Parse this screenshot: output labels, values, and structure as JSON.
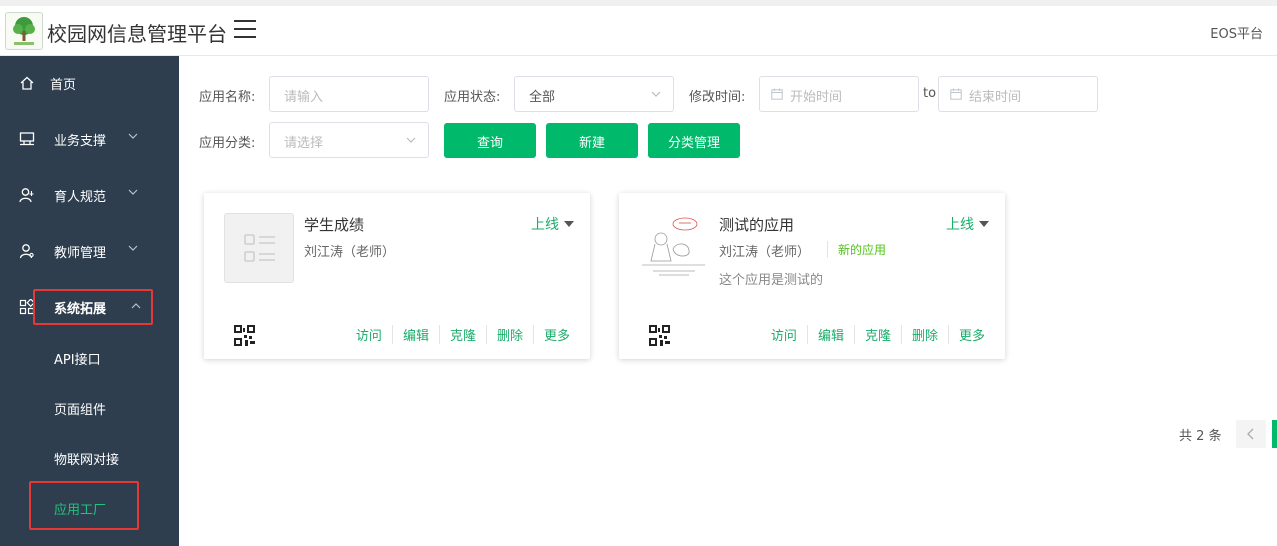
{
  "header": {
    "title": "校园网信息管理平台",
    "platform": "EOS平台"
  },
  "sidebar": {
    "items": [
      {
        "label": "首页",
        "icon": "home-icon"
      },
      {
        "label": "业务支撑",
        "icon": "monitor-icon"
      },
      {
        "label": "育人规范",
        "icon": "user-icon"
      },
      {
        "label": "教师管理",
        "icon": "teacher-icon"
      },
      {
        "label": "系统拓展",
        "icon": "apps-icon"
      }
    ],
    "sub_items": [
      {
        "label": "API接口"
      },
      {
        "label": "页面组件"
      },
      {
        "label": "物联网对接"
      },
      {
        "label": "应用工厂"
      }
    ],
    "active_color": "#1fc57c",
    "bg_color": "#2e3e4e"
  },
  "filters": {
    "name_label": "应用名称:",
    "name_placeholder": "请输入",
    "status_label": "应用状态:",
    "status_value": "全部",
    "time_label": "修改时间:",
    "start_placeholder": "开始时间",
    "to_label": "to",
    "end_placeholder": "结束时间",
    "category_label": "应用分类:",
    "category_placeholder": "请选择"
  },
  "buttons": {
    "query": "查询",
    "create": "新建",
    "category_manage": "分类管理",
    "color": "#00b96b"
  },
  "cards": [
    {
      "name": "学生成绩",
      "author": "刘江涛（老师）",
      "status": "上线",
      "actions": [
        "访问",
        "编辑",
        "克隆",
        "删除",
        "更多"
      ]
    },
    {
      "name": "测试的应用",
      "author": "刘江涛（老师）",
      "tag": "新的应用",
      "description": "这个应用是测试的",
      "status": "上线",
      "actions": [
        "访问",
        "编辑",
        "克隆",
        "删除",
        "更多"
      ]
    }
  ],
  "pagination": {
    "total_text": "共 2 条"
  }
}
